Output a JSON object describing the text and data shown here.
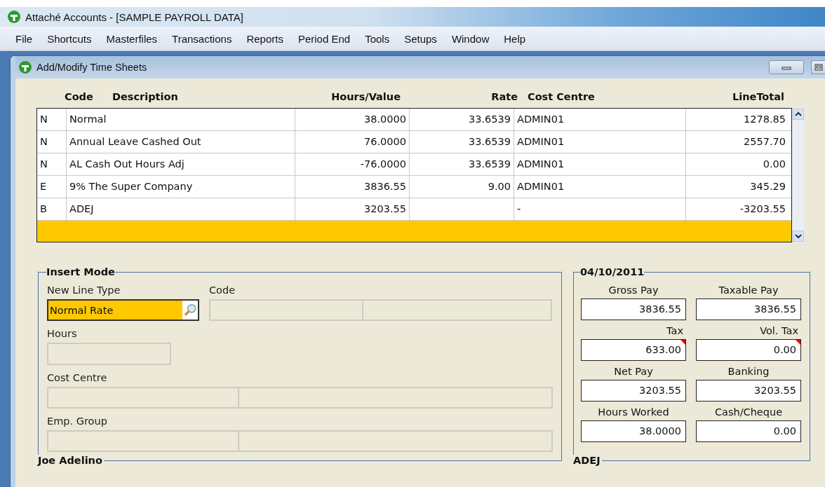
{
  "window": {
    "title": "Attaché Accounts - [SAMPLE PAYROLL DATA]"
  },
  "menu": [
    "File",
    "Shortcuts",
    "Masterfiles",
    "Transactions",
    "Reports",
    "Period End",
    "Tools",
    "Setups",
    "Window",
    "Help"
  ],
  "child_window": {
    "title": "Add/Modify Time Sheets"
  },
  "table": {
    "header_labels": [
      "Code",
      "Description",
      "Hours/Value",
      "Rate",
      "Cost Centre",
      "LineTotal"
    ],
    "rows": [
      [
        "N",
        "Normal",
        "38.0000",
        "33.6539",
        "ADMIN01",
        "1278.85"
      ],
      [
        "N",
        "Annual Leave Cashed Out",
        "76.0000",
        "33.6539",
        "ADMIN01",
        "2557.70"
      ],
      [
        "N",
        "AL Cash Out Hours Adj",
        "-76.0000",
        "33.6539",
        "ADMIN01",
        "0.00"
      ],
      [
        "E",
        "9% The Super Company",
        "3836.55",
        "9.00",
        "ADMIN01",
        "345.29"
      ],
      [
        "B",
        "ADEJ",
        "3203.55",
        "",
        "-",
        "-3203.55"
      ]
    ],
    "new_row_highlighted": true
  },
  "insert_panel": {
    "title": "Insert Mode",
    "footer": "Joe Adelino",
    "new_line_type": {
      "label": "New Line Type",
      "value": "Normal Rate"
    },
    "code": {
      "label": "Code"
    },
    "hours": {
      "label": "Hours"
    },
    "cost_centre": {
      "label": "Cost Centre"
    },
    "emp_group": {
      "label": "Emp. Group"
    }
  },
  "totals_panel": {
    "title": "04/10/2011",
    "footer": "ADEJ",
    "fields": [
      {
        "label": "Gross Pay",
        "value": "3836.55",
        "flagged": false
      },
      {
        "label": "Taxable Pay",
        "value": "3836.55",
        "flagged": false
      },
      {
        "label": "Tax",
        "value": "633.00",
        "flagged": true
      },
      {
        "label": "Vol. Tax",
        "value": "0.00",
        "flagged": true
      },
      {
        "label": "Net Pay",
        "value": "3203.55",
        "flagged": false
      },
      {
        "label": "Banking",
        "value": "3203.55",
        "flagged": false
      },
      {
        "label": "Hours Worked",
        "value": "38.0000",
        "flagged": false
      },
      {
        "label": "Cash/Cheque",
        "value": "0.00",
        "flagged": false
      }
    ]
  }
}
